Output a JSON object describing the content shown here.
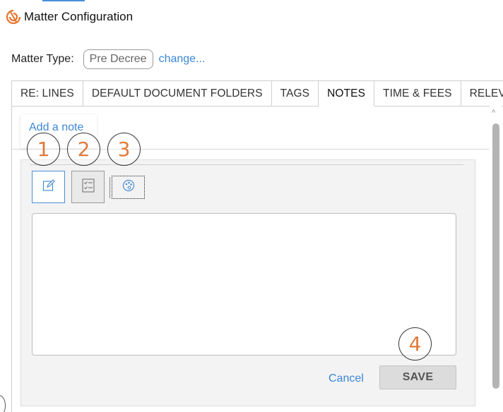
{
  "window": {
    "title": "Matter Configuration",
    "logo_icon": "brand-logo-icon"
  },
  "matter_type": {
    "label": "Matter Type:",
    "value": "Pre Decree",
    "change_link": "change..."
  },
  "tabs": [
    {
      "label": "RE: LINES",
      "active": false
    },
    {
      "label": "DEFAULT DOCUMENT FOLDERS",
      "active": false
    },
    {
      "label": "TAGS",
      "active": false
    },
    {
      "label": "NOTES",
      "active": true
    },
    {
      "label": "TIME & FEES",
      "active": false
    },
    {
      "label": "RELEV",
      "active": false
    }
  ],
  "notes": {
    "add_note_link": "Add a note",
    "toolbar": [
      {
        "name": "edit-note",
        "icon": "edit-icon"
      },
      {
        "name": "checklist",
        "icon": "checklist-icon"
      },
      {
        "name": "palette",
        "icon": "palette-icon"
      }
    ],
    "textarea_value": "",
    "cancel_label": "Cancel",
    "save_label": "SAVE"
  },
  "annotations": [
    "1",
    "2",
    "3",
    "4"
  ],
  "colors": {
    "accent": "#3b87d6",
    "annotation": "#e07a3a",
    "brand": "#e8732c"
  }
}
